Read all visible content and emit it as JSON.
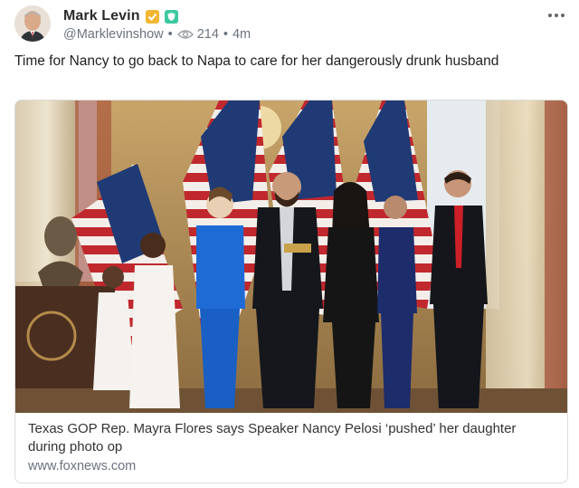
{
  "author": {
    "display_name": "Mark Levin",
    "handle": "@Marklevinshow",
    "views": "214",
    "time_ago": "4m",
    "badges": [
      {
        "name": "gold-verified-badge",
        "color": "#f2b632"
      },
      {
        "name": "green-shield-badge",
        "color": "#3cc9a0"
      }
    ]
  },
  "post": {
    "text": "Time for Nancy to go back to Napa to care for her dangerously drunk husband"
  },
  "link_card": {
    "title": "Texas GOP Rep. Mayra Flores says Speaker Nancy Pelosi ‘pushed’ her daughter during photo op",
    "domain": "www.foxnews.com"
  },
  "icons": {
    "views": "eye-icon",
    "menu": "more-options-icon"
  },
  "separators": {
    "dot": "•"
  }
}
